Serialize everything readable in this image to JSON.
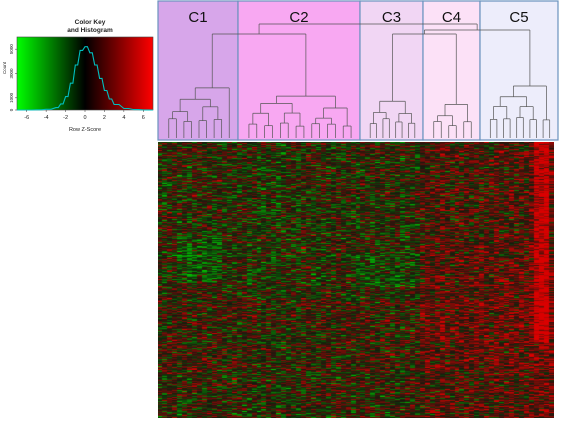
{
  "chart_data": [
    {
      "type": "histogram",
      "title": "Color Key\nand Histogram",
      "xlabel": "Row Z-Score",
      "ylabel": "Count",
      "xlim": [
        -7,
        7
      ],
      "ylim": [
        0,
        6000
      ],
      "x_ticks": [
        -6,
        -4,
        -2,
        0,
        2,
        4,
        6
      ],
      "y_ticks": [
        0,
        1000,
        3000,
        5000
      ],
      "color_scale": [
        "#00ff00",
        "#000000",
        "#ff0000"
      ],
      "density_curve": {
        "x": [
          -7,
          -6,
          -5,
          -4,
          -3,
          -2.5,
          -2,
          -1.5,
          -1,
          -0.5,
          0,
          0.5,
          1,
          1.5,
          2,
          2.5,
          3,
          4,
          5,
          6,
          7
        ],
        "y": [
          0,
          0,
          20,
          60,
          200,
          500,
          1100,
          2200,
          3700,
          4900,
          5200,
          4700,
          3700,
          2600,
          1600,
          900,
          450,
          120,
          30,
          5,
          0
        ]
      },
      "histogram_line_color": "#00bfbf"
    },
    {
      "type": "heatmap",
      "clusters": [
        {
          "label": "C1",
          "color": "#d7a6ea"
        },
        {
          "label": "C2",
          "color": "#f8a8f2"
        },
        {
          "label": "C3",
          "color": "#f1d6f4"
        },
        {
          "label": "C4",
          "color": "#fce1f7"
        },
        {
          "label": "C5",
          "color": "#ededfb"
        }
      ],
      "cluster_border_color": "#6a93bf",
      "color_scale": [
        "#00cc00",
        "#111111",
        "#dd0000"
      ],
      "dendrogram_color": "#555555"
    }
  ]
}
